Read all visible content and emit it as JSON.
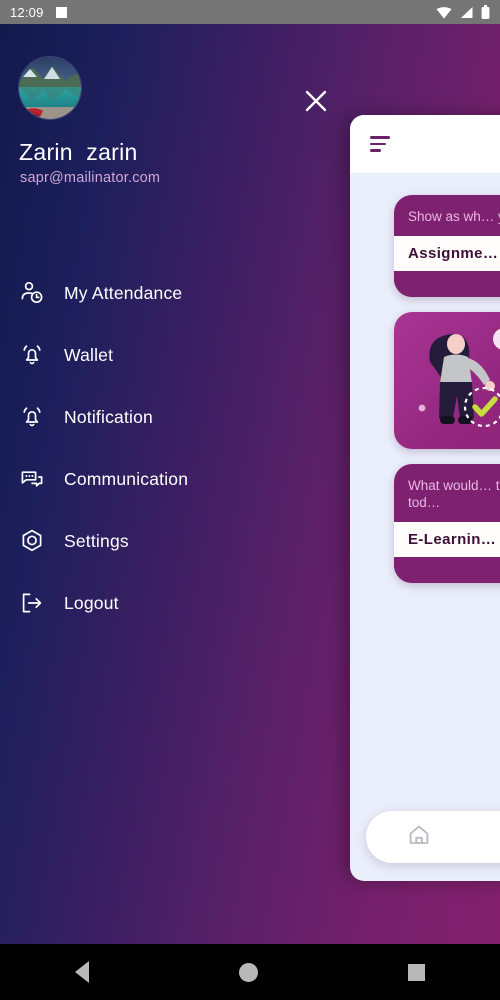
{
  "status_bar": {
    "time": "12:09",
    "icons": [
      "app-indicator-square",
      "wifi-icon",
      "signal-icon",
      "battery-icon"
    ]
  },
  "drawer": {
    "profile": {
      "name": "Zarin  zarin",
      "email": "sapr@mailinator.com",
      "avatar_alt": "mountain-lake-photo"
    },
    "close_label": "✕",
    "menu_items": [
      {
        "label": "My Attendance",
        "icon": "user-clock-icon"
      },
      {
        "label": "Wallet",
        "icon": "bell-icon"
      },
      {
        "label": "Notification",
        "icon": "bell-icon"
      },
      {
        "label": "Communication",
        "icon": "chat-bubble-icon"
      },
      {
        "label": "Settings",
        "icon": "hexagon-gear-icon"
      },
      {
        "label": "Logout",
        "icon": "logout-arrow-icon"
      }
    ]
  },
  "content_panel": {
    "menu_icon": "filter-lines-icon",
    "cards": [
      {
        "question": "Show as wh… you learn",
        "title": "Assignme…"
      },
      {
        "illustration": "woman-checkmark-illustration"
      },
      {
        "question": "What would… to learn tod…",
        "title": "E-Learnin…"
      }
    ],
    "bottom_nav": {
      "home_icon": "home-icon"
    }
  },
  "system_nav": {
    "back": "back-triangle",
    "home": "home-circle",
    "recents": "recents-square"
  },
  "colors": {
    "gradient_start": "#121a4c",
    "gradient_end": "#83206d",
    "panel_bg": "#eaeefb",
    "card_purple": "#7d2170",
    "email_text": "#cfa8d8"
  }
}
